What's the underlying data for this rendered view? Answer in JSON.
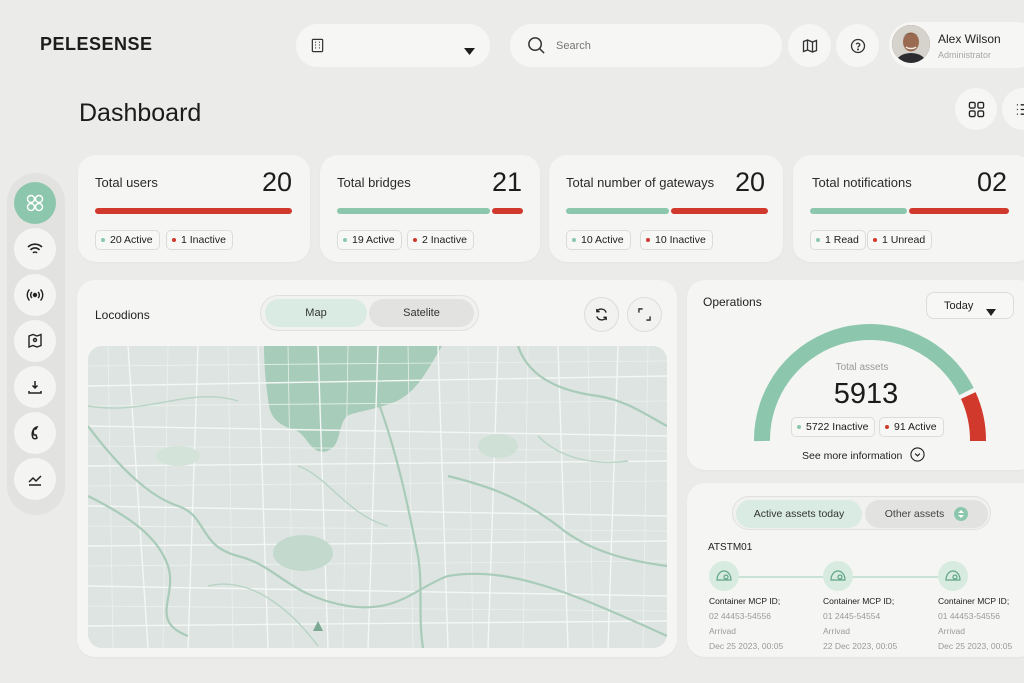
{
  "app": {
    "logo": "PELESENSE"
  },
  "header": {
    "search_placeholder": "Search",
    "user": {
      "name": "Alex Wilson",
      "role": "Administrator"
    }
  },
  "page": {
    "title": "Dashboard"
  },
  "colors": {
    "accent": "#8cc7ad",
    "danger": "#d0392b",
    "background": "#ebebea"
  },
  "stats": [
    {
      "title": "Total users",
      "value": "20",
      "chip1": "20 Active",
      "chip2": "1 Inactive",
      "green_fraction": 0.0
    },
    {
      "title": "Total bridges",
      "value": "21",
      "chip1": "19 Active",
      "chip2": "2 Inactive",
      "green_fraction": 0.84
    },
    {
      "title": "Total number of gateways",
      "value": "20",
      "chip1": "10 Active",
      "chip2": "10 Inactive",
      "green_fraction": 0.5
    },
    {
      "title": "Total notifications",
      "value": "02",
      "chip1": "1 Read",
      "chip2": "1 Unread",
      "green_fraction": 0.5
    }
  ],
  "sidebar": {
    "icons": [
      "grid-icon",
      "wifi-icon",
      "signal-icon",
      "map-icon",
      "download-icon",
      "phone-icon",
      "chart-icon"
    ]
  },
  "locations": {
    "title": "Locodions",
    "tabs": [
      "Map",
      "Satelite"
    ],
    "active_tab": "Map"
  },
  "operations": {
    "title": "Operations",
    "period": "Today",
    "gauge_label": "Total assets",
    "total": "5913",
    "inactive": "5722 Inactive",
    "active": "91 Active",
    "active_fraction": 0.12,
    "more_link": "See more information"
  },
  "assets": {
    "tabs": [
      "Active assets today",
      "Other assets"
    ],
    "id": "ATSTM01",
    "timeline": [
      {
        "label": "Container MCP ID;",
        "id": "02 44453-54556",
        "status": "Arrivad",
        "date": "Dec 25 2023, 00:05"
      },
      {
        "label": "Container MCP ID;",
        "id": "01 2445-54554",
        "status": "Arrivad",
        "date": "22 Dec 2023, 00:05"
      },
      {
        "label": "Container MCP ID;",
        "id": "01 44453-54556",
        "status": "Arrivad",
        "date": "Dec 25 2023, 00:05"
      }
    ]
  }
}
